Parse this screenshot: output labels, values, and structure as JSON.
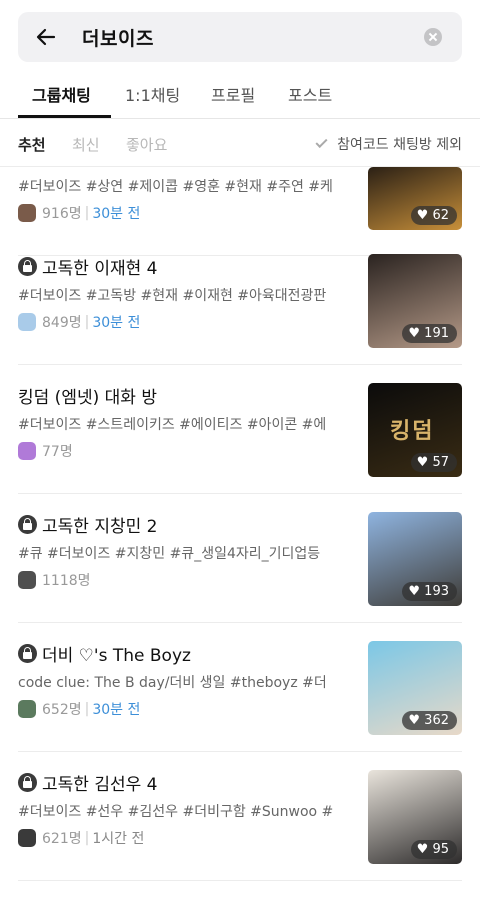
{
  "search": {
    "query": "더보이즈"
  },
  "tabs": [
    "그룹채팅",
    "1:1채팅",
    "프로필",
    "포스트"
  ],
  "filters": {
    "recommended": "추천",
    "latest": "최신",
    "likes": "좋아요",
    "exclude_label": "참여코드 채팅방 제외"
  },
  "rooms": [
    {
      "locked": false,
      "title": "",
      "tags": "#더보이즈 #상연 #제이콥 #영훈 #현재 #주연 #케",
      "members": "916명",
      "time": "30분 전",
      "time_recent": true,
      "likes": "62",
      "avatar_color": "#7a5b4a",
      "thumb_colors": [
        "#2b2015",
        "#c8903a"
      ]
    },
    {
      "locked": true,
      "title": "고독한 이재현 4",
      "tags": "#더보이즈 #고독방 #현재 #이재현 #아육대전광판",
      "members": "849명",
      "time": "30분 전",
      "time_recent": true,
      "likes": "191",
      "avatar_color": "#a9cbe9",
      "thumb_colors": [
        "#2a2320",
        "#b59a88"
      ]
    },
    {
      "locked": false,
      "title": "킹덤 (엠넷) 대화 방",
      "tags": "#더보이즈 #스트레이키즈 #에이티즈 #아이콘 #에",
      "members": "77명",
      "time": "",
      "time_recent": false,
      "likes": "57",
      "avatar_color": "#b07ad8",
      "thumb_colors": [
        "#0b0b0b",
        "#3a2c14"
      ],
      "thumb_text": "킹덤"
    },
    {
      "locked": true,
      "title": "고독한 지창민 2",
      "tags": "#큐 #더보이즈 #지창민 #큐_생일4자리_기디업등",
      "members": "1118명",
      "time": "",
      "time_recent": false,
      "likes": "193",
      "avatar_color": "#4f4f4f",
      "thumb_colors": [
        "#8fb4e0",
        "#3e3b36"
      ]
    },
    {
      "locked": true,
      "title": "더비 ♡'s The Boyz",
      "tags": "code clue: The B day/더비 생일 #theboyz #더",
      "members": "652명",
      "time": "30분 전",
      "time_recent": true,
      "likes": "362",
      "avatar_color": "#5b7a5e",
      "thumb_colors": [
        "#7bc7e6",
        "#e8d9c8"
      ]
    },
    {
      "locked": true,
      "title": "고독한 김선우 4",
      "tags": "#더보이즈 #선우 #김선우 #더비구함 #Sunwoo #",
      "members": "621명",
      "time": "1시간 전",
      "time_recent": false,
      "likes": "95",
      "avatar_color": "#3a3a3a",
      "thumb_colors": [
        "#e9e4dc",
        "#2d2b2b"
      ]
    }
  ]
}
